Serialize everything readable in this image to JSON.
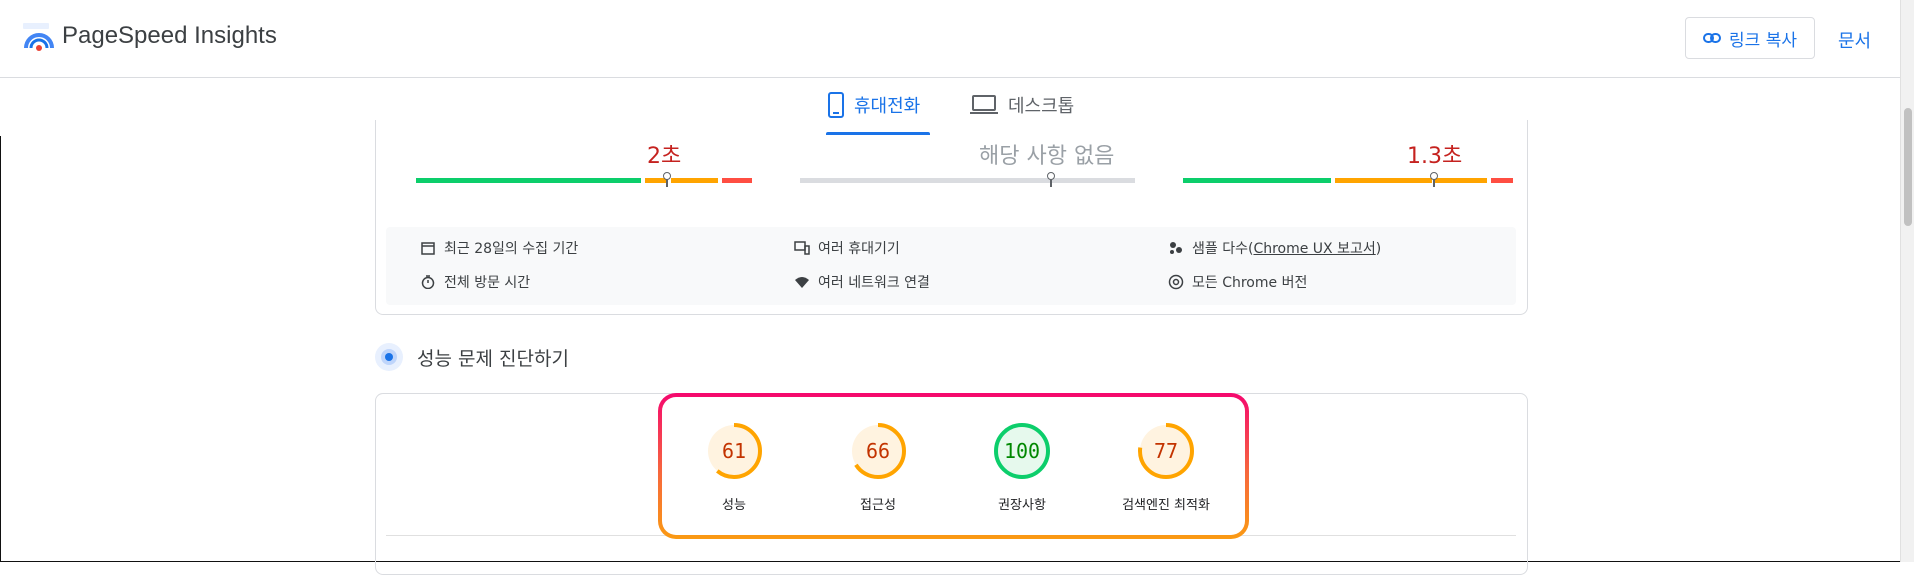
{
  "header": {
    "brand": "PageSpeed Insights",
    "copy_link_label": "링크 복사",
    "docs_label": "문서"
  },
  "tabs": [
    {
      "label": "휴대전화",
      "icon": "phone-icon",
      "active": true
    },
    {
      "label": "데스크톱",
      "icon": "laptop-icon",
      "active": false
    }
  ],
  "metrics": [
    {
      "value": "2초",
      "color": "#c5221f",
      "segments": [
        "#0cce6b",
        "#ffa400",
        "#ff4e42"
      ],
      "marker_fraction": 0.75
    },
    {
      "value": "해당 사항 없음",
      "color": "#9aa0a6",
      "segments": [
        "#dadce0"
      ],
      "marker_fraction": 0.75
    },
    {
      "value": "1.3초",
      "color": "#c5221f",
      "segments": [
        "#0cce6b",
        "#ffa400",
        "#ff4e42"
      ],
      "marker_fraction": 0.75
    }
  ],
  "info": {
    "period": "최근 28일의 수집 기간",
    "devices": "여러 휴대기기",
    "samples_prefix": "샘플 다수(",
    "samples_link": "Chrome UX 보고서",
    "samples_suffix": ")",
    "visit": "전체 방문 시간",
    "network": "여러 네트워크 연결",
    "chrome": "모든 Chrome 버전"
  },
  "diagnose": {
    "title": "성능 문제 진단하기"
  },
  "scores": [
    {
      "value": "61",
      "label": "성능",
      "status": "average",
      "color": "#ffa400",
      "text_color": "#c33300",
      "fill": "#fff3e0",
      "fraction": 0.61
    },
    {
      "value": "66",
      "label": "접근성",
      "status": "average",
      "color": "#ffa400",
      "text_color": "#c33300",
      "fill": "#fff3e0",
      "fraction": 0.66
    },
    {
      "value": "100",
      "label": "권장사항",
      "status": "good",
      "color": "#0cce6b",
      "text_color": "#008800",
      "fill": "#e6f9ed",
      "fraction": 1.0
    },
    {
      "value": "77",
      "label": "검색엔진 최적화",
      "status": "average",
      "color": "#ffa400",
      "text_color": "#c33300",
      "fill": "#fff3e0",
      "fraction": 0.77
    }
  ]
}
